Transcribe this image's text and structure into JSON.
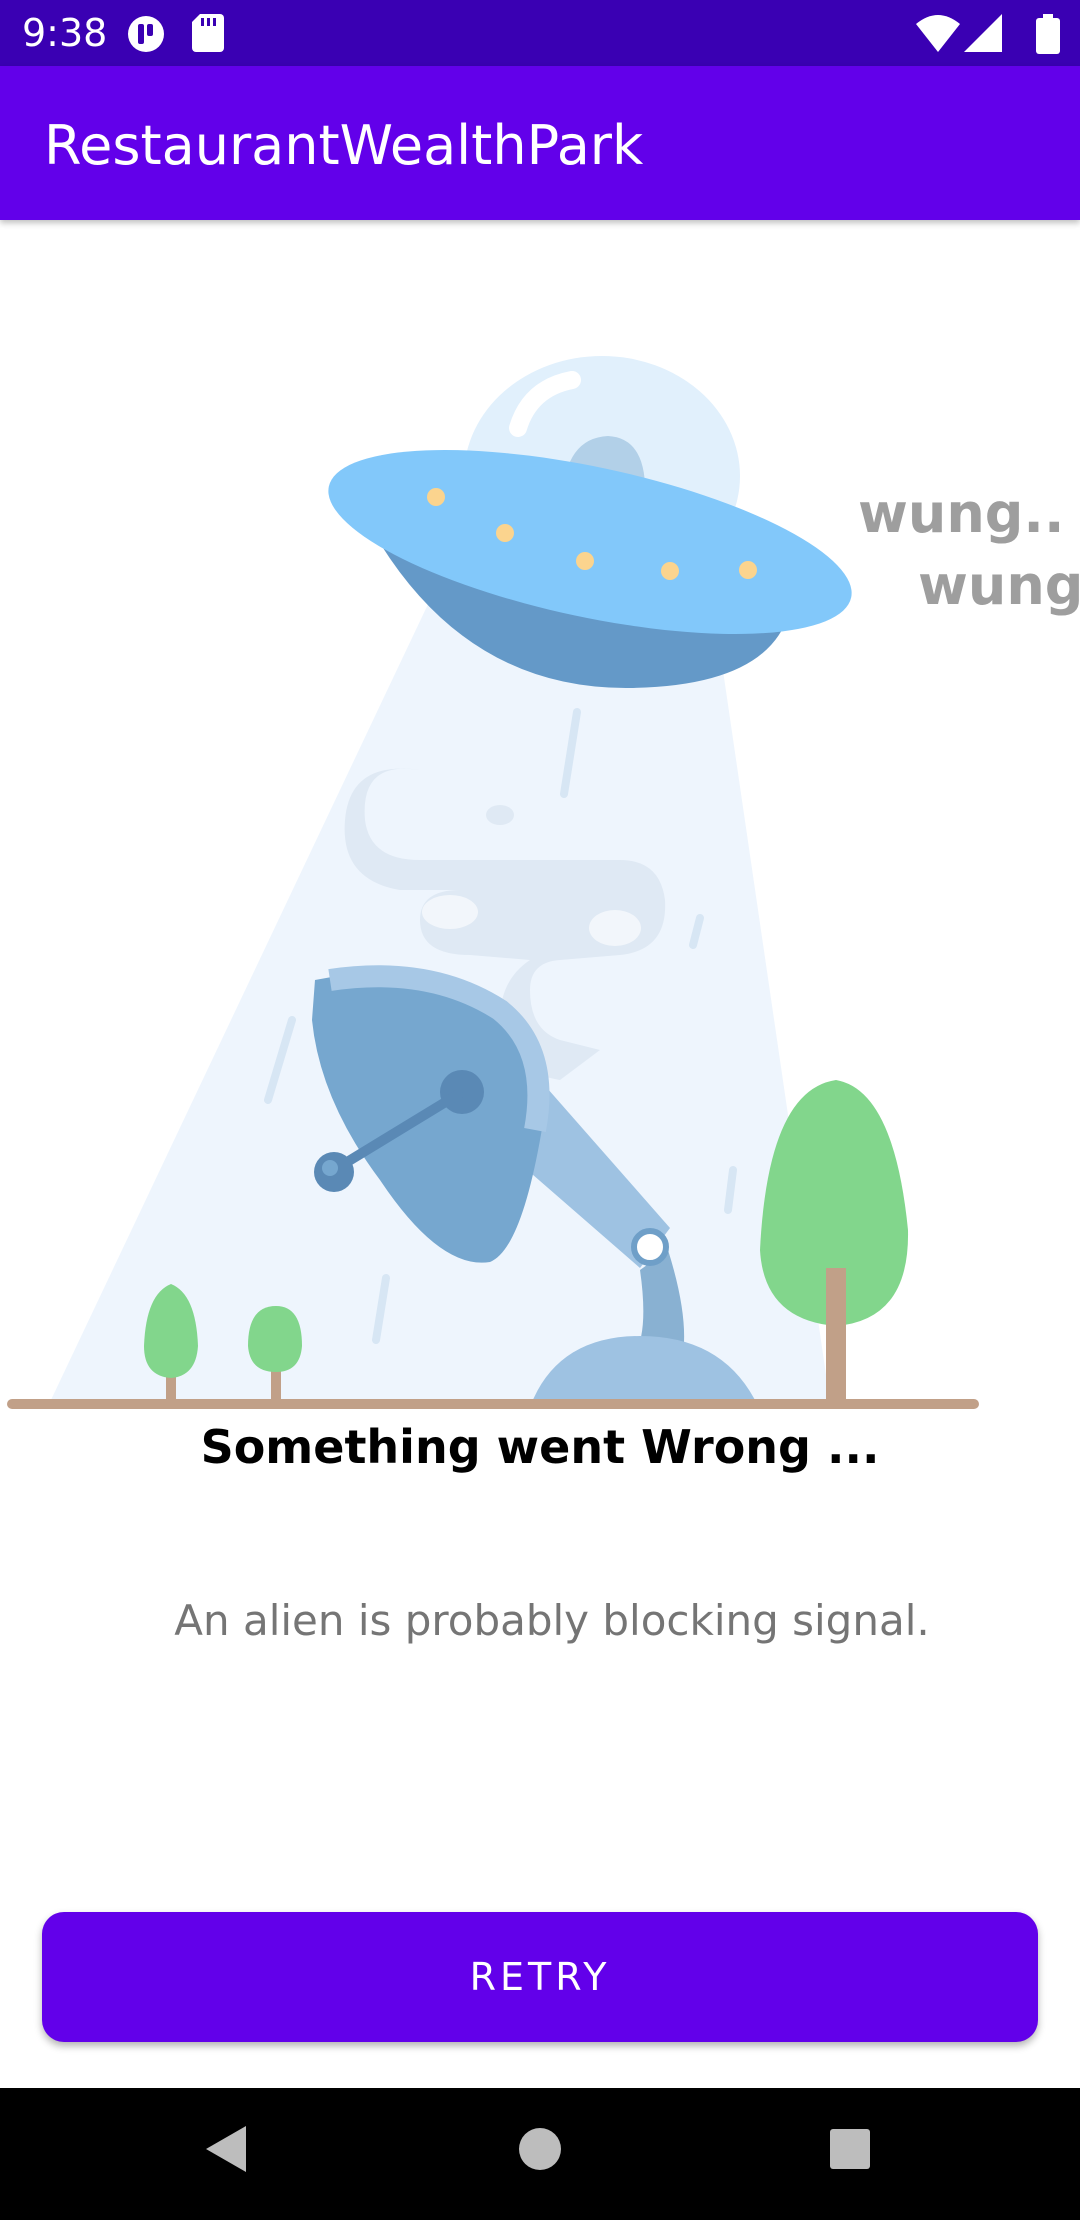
{
  "status_bar": {
    "time": "9:38",
    "icons": [
      "notification-app-icon",
      "sd-card-icon",
      "wifi-icon",
      "cell-signal-icon",
      "battery-icon"
    ]
  },
  "app_bar": {
    "title": "RestaurantWealthPark"
  },
  "illustration": {
    "description_icon": "ufo-abducting-satellite-dish-illustration",
    "sound_text_1": "wung..",
    "sound_text_2": "wung.."
  },
  "error": {
    "title": "Something went Wrong ...",
    "subtitle": "An alien is probably blocking signal."
  },
  "retry_button": {
    "label": "RETRY"
  },
  "nav_bar": {
    "buttons": [
      "back-icon",
      "home-icon",
      "recents-icon"
    ]
  },
  "colors": {
    "status_bar": "#3a00b3",
    "primary": "#6200ea",
    "ufo_light": "#82c8fa",
    "ufo_dark": "#6499c8",
    "tree": "#82d68c",
    "ground": "#c1a088"
  }
}
